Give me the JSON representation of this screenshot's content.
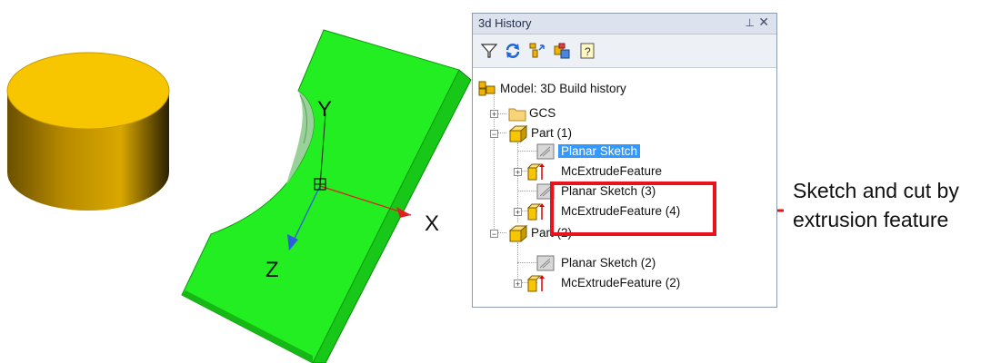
{
  "panel": {
    "title": "3d History",
    "pin_glyph": "⊥",
    "close_glyph": "✕",
    "toolbar": [
      {
        "icon": "filter-icon"
      },
      {
        "icon": "refresh-icon"
      },
      {
        "icon": "history-tree-icon"
      },
      {
        "icon": "parts-icon"
      },
      {
        "icon": "help-icon"
      }
    ],
    "tree": [
      {
        "label": "Model: 3D Build history",
        "icon": "model-icon"
      },
      {
        "label": "GCS",
        "icon": "folder-icon"
      },
      {
        "label": "Part (1)",
        "icon": "part-icon"
      },
      {
        "label": "Planar Sketch",
        "icon": "sketch-icon",
        "selected": true
      },
      {
        "label": "McExtrudeFeature",
        "icon": "extrude-icon"
      },
      {
        "label": "Planar Sketch (3)",
        "icon": "sketch-icon"
      },
      {
        "label": "McExtrudeFeature (4)",
        "icon": "extrude-icon"
      },
      {
        "label": "Part (2)",
        "icon": "part-icon"
      },
      {
        "label": "Planar Sketch (2)",
        "icon": "sketch-icon"
      },
      {
        "label": "McExtrudeFeature (2)",
        "icon": "extrude-icon"
      }
    ]
  },
  "viewport": {
    "axis_x": "X",
    "axis_y": "Y",
    "axis_z": "Z",
    "colors": {
      "cylinder": "#f7c600",
      "block": "#22ee22",
      "highlight": "#e8141c"
    }
  },
  "callout": {
    "line1": "Sketch and cut by",
    "line2": "extrusion feature"
  }
}
